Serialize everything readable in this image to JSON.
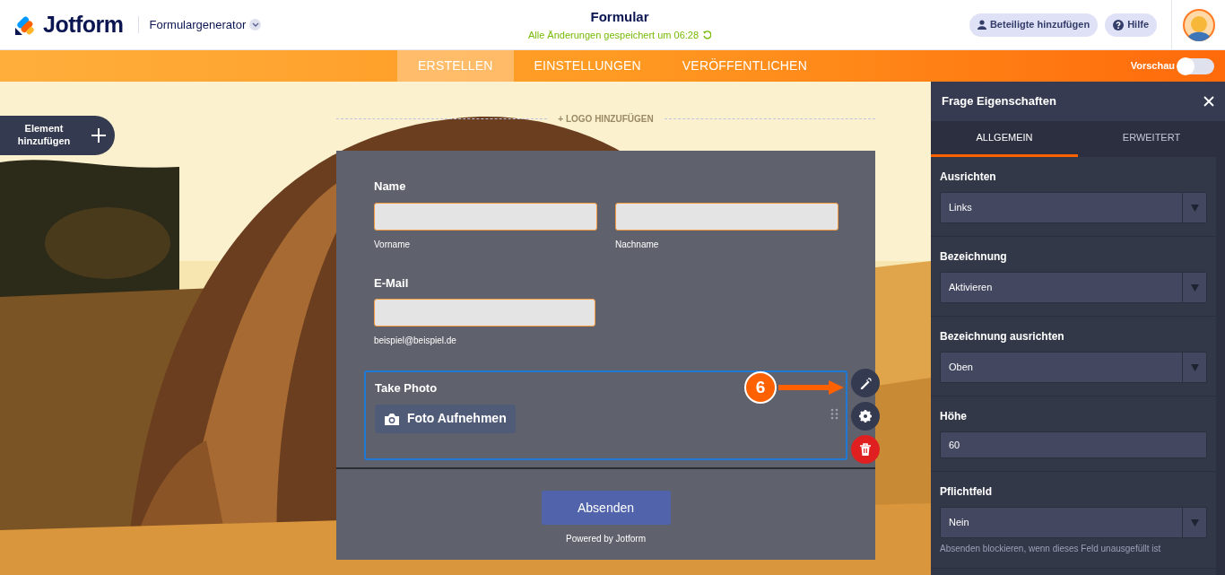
{
  "header": {
    "logo": "Jotform",
    "product": "Formulargenerator",
    "title": "Formular",
    "saved_status": "Alle Änderungen gespeichert um 06:28",
    "buttons": [
      {
        "label": "Beteiligte hinzufügen",
        "kind": "person"
      },
      {
        "label": "Hilfe",
        "kind": "help"
      }
    ]
  },
  "tabs": [
    {
      "label": "ERSTELLEN",
      "selected": true
    },
    {
      "label": "EINSTELLUNGEN",
      "selected": false
    },
    {
      "label": "VERÖFFENTLICHEN",
      "selected": false
    }
  ],
  "preview": {
    "label": "Vorschau",
    "on": false
  },
  "add_element": {
    "label": "Element hinzufügen"
  },
  "logo_placeholder": "+ LOGO HINZUFÜGEN",
  "form": {
    "fields": [
      {
        "kind": "name",
        "label": "Name",
        "sublabels": [
          "Vorname",
          "Nachname"
        ],
        "selected": false
      },
      {
        "kind": "email",
        "label": "E-Mail",
        "sublabels": [
          "beispiel@beispiel.de"
        ],
        "selected": false
      },
      {
        "label": "Take Photo",
        "button": "Foto Aufnehmen",
        "selected": true
      }
    ],
    "submit": "Absenden",
    "powered_by": "Powered by Jotform"
  },
  "callout": {
    "number": "6"
  },
  "panel": {
    "title": "Frage Eigenschaften",
    "tabs": [
      {
        "label": "ALLGEMEIN",
        "selected": true
      },
      {
        "label": "ERWEITERT",
        "selected": false
      }
    ],
    "properties": [
      {
        "kind": "select",
        "label": "Ausrichten",
        "value": "Links"
      },
      {
        "kind": "select",
        "label": "Bezeichnung",
        "value": "Aktivieren"
      },
      {
        "kind": "select",
        "label": "Bezeichnung ausrichten",
        "value": "Oben"
      },
      {
        "kind": "text",
        "label": "Höhe",
        "value": "60"
      },
      {
        "kind": "select",
        "label": "Pflichtfeld",
        "value": "Nein",
        "hint": "Absenden blockieren, wenn dieses Feld unausgefüllt ist"
      }
    ]
  }
}
